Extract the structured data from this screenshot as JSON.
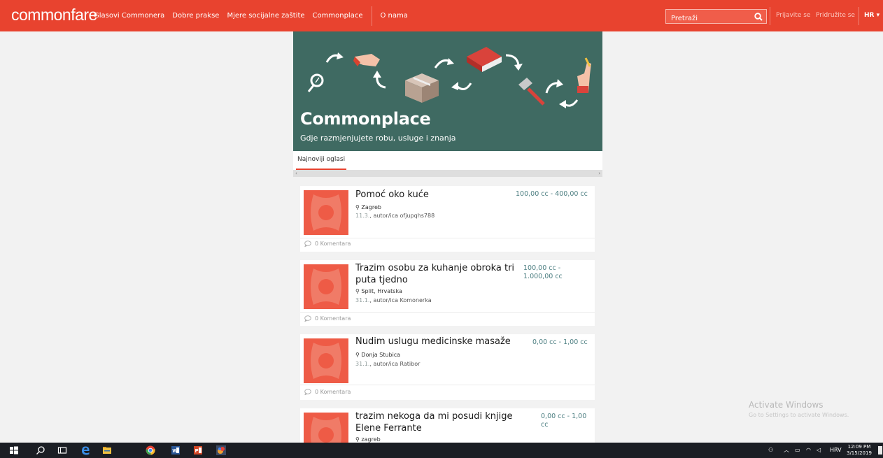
{
  "header": {
    "logo": "commonfare",
    "nav": [
      "Glasovi Commonera",
      "Dobre prakse",
      "Mjere socijalne zaštite",
      "Commonplace",
      "O nama"
    ],
    "search_placeholder": "Pretraži",
    "login": "Prijavite se",
    "join": "Pridružite se",
    "language": "HR"
  },
  "hero": {
    "title": "Commonplace",
    "subtitle": "Gdje razmjenjujete robu, usluge i znanja"
  },
  "tabs": [
    "Najnoviji oglasi"
  ],
  "scroll_arrows": {
    "left": "‹",
    "right": "›"
  },
  "listings": [
    {
      "title": "Pomoć oko kuće",
      "price": "100,00 cc - 400,00 cc",
      "location": "Zagreb",
      "date": "11.3.",
      "author": "autor/ica ofjupqhs788",
      "comments": "0 Komentara"
    },
    {
      "title": "Trazim osobu za kuhanje obroka tri puta tjedno",
      "price": "100,00 cc - 1.000,00 cc",
      "location": "Split, Hrvatska",
      "date": "31.1.",
      "author": "autor/ica Komonerka",
      "comments": "0 Komentara"
    },
    {
      "title": "Nudim uslugu medicinske masaže",
      "price": "0,00 cc - 1,00 cc",
      "location": "Donja Stubica",
      "date": "31.1.",
      "author": "autor/ica Ratibor",
      "comments": "0 Komentara"
    },
    {
      "title": "trazim nekoga da mi posudi knjige Elene Ferrante",
      "price": "0,00 cc - 1,00 cc",
      "location": "zagreb",
      "date": "",
      "author": "",
      "comments": ""
    }
  ],
  "watermark": {
    "title": "Activate Windows",
    "subtitle": "Go to Settings to activate Windows."
  },
  "taskbar": {
    "language": "HRV",
    "time": "12:09 PM",
    "date": "3/15/2019"
  },
  "colors": {
    "brand": "#e8432f",
    "hero": "#3f6a62",
    "thumb": "#ee5b46",
    "price": "#4d7f82"
  }
}
